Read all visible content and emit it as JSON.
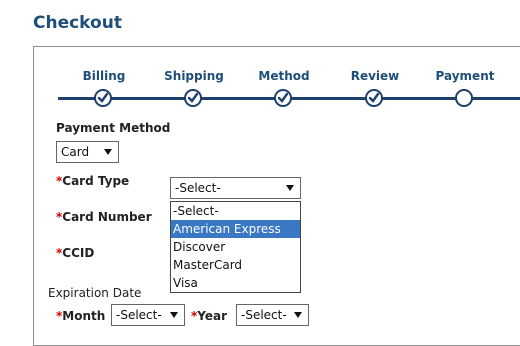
{
  "page": {
    "title": "Checkout"
  },
  "steps": [
    {
      "label": "Billing",
      "state": "complete"
    },
    {
      "label": "Shipping",
      "state": "complete"
    },
    {
      "label": "Method",
      "state": "complete"
    },
    {
      "label": "Review",
      "state": "complete"
    },
    {
      "label": "Payment",
      "state": "current"
    }
  ],
  "form": {
    "payment_method": {
      "label": "Payment Method",
      "value": "Card"
    },
    "required_mark": "*",
    "card_type": {
      "label": "Card Type",
      "value": "-Select-",
      "options": [
        "-Select-",
        "American Express",
        "Discover",
        "MasterCard",
        "Visa"
      ],
      "highlighted_index": 1
    },
    "card_number": {
      "label": "Card Number"
    },
    "ccid": {
      "label": "CCID"
    },
    "expiration": {
      "label": "Expiration Date",
      "month": {
        "label": "Month",
        "value": "-Select-"
      },
      "year": {
        "label": "Year",
        "value": "-Select-"
      }
    }
  },
  "colors": {
    "title": "#1f4e79",
    "track": "#1f3f6d",
    "highlight": "#3a78c3",
    "required": "#cc0000"
  }
}
